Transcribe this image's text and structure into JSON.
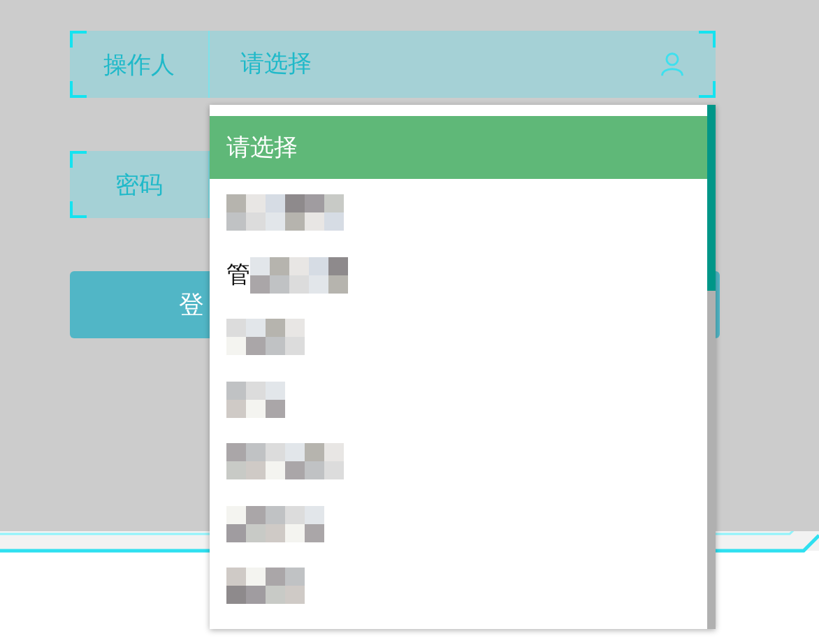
{
  "form": {
    "operator": {
      "label": "操作人",
      "placeholder": "请选择"
    },
    "password": {
      "label": "密码"
    },
    "login_button": {
      "label": "登"
    }
  },
  "dropdown": {
    "options": [
      {
        "kind": "text",
        "label": "请选择",
        "selected": true
      },
      {
        "kind": "redacted",
        "selected": false
      },
      {
        "kind": "partial",
        "label": "管",
        "selected": false
      },
      {
        "kind": "redacted",
        "selected": false
      },
      {
        "kind": "redacted",
        "selected": false
      },
      {
        "kind": "redacted",
        "selected": false
      },
      {
        "kind": "redacted",
        "selected": false
      },
      {
        "kind": "redacted",
        "selected": false
      }
    ]
  }
}
